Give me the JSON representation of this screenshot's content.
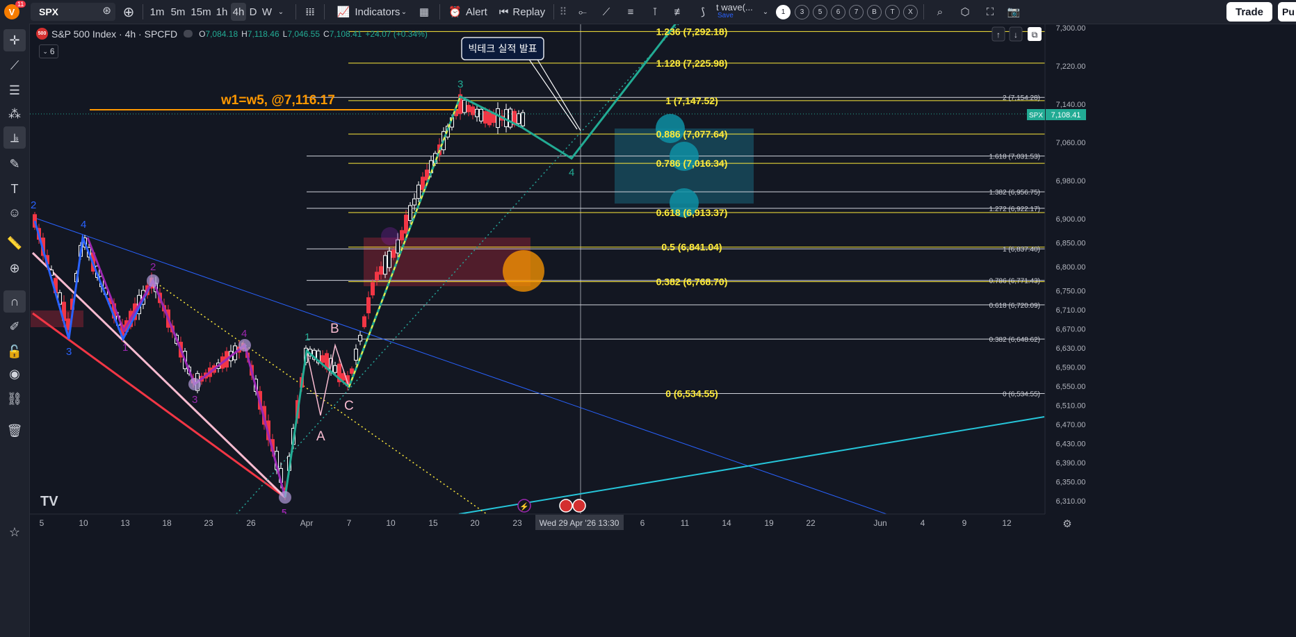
{
  "app": {
    "avatar_letter": "V",
    "notif_count": "11"
  },
  "toolbar": {
    "symbol": "SPX",
    "intervals": [
      "1m",
      "5m",
      "15m",
      "1h",
      "4h",
      "D",
      "W"
    ],
    "active_interval": "4h",
    "indicators_label": "Indicators",
    "alert_label": "Alert",
    "replay_label": "Replay",
    "template_name": "t wave(...",
    "template_save": "Save",
    "number_buttons": [
      "1",
      "3",
      "5",
      "6",
      "7",
      "B",
      "T",
      "X"
    ],
    "selected_number": "1",
    "trade_label": "Trade",
    "publish_label": "Pu"
  },
  "legend": {
    "logo_text": "500",
    "title": "S&P 500 Index · 4h · SPCFD",
    "o_label": "O",
    "o_value": "7,084.18",
    "h_label": "H",
    "h_value": "7,118.46",
    "l_label": "L",
    "l_value": "7,046.55",
    "c_label": "C",
    "c_value": "7,108.41",
    "change": "+24.07 (+0.34%)",
    "collapse_count": "6"
  },
  "price_axis": {
    "ticks": [
      "7,300.00",
      "7,220.00",
      "7,140.00",
      "7,060.00",
      "6,980.00",
      "6,900.00",
      "6,850.00",
      "6,800.00",
      "6,750.00",
      "6,710.00",
      "6,670.00",
      "6,630.00",
      "6,590.00",
      "6,550.00",
      "6,510.00",
      "6,470.00",
      "6,430.00",
      "6,390.00",
      "6,350.00",
      "6,310.00"
    ],
    "current_symbol": "SPX",
    "current_price": "7,108.41"
  },
  "time_axis": {
    "ticks": [
      "5",
      "10",
      "13",
      "18",
      "23",
      "26",
      "Apr",
      "7",
      "10",
      "15",
      "20",
      "23",
      "6",
      "11",
      "14",
      "19",
      "22",
      "Jun",
      "4",
      "9",
      "12"
    ],
    "crosshair_label": "Wed 29 Apr '26   13:30"
  },
  "annotations": {
    "target_note": "w1=w5, @7,116.17",
    "callout": "빅테크 실적 발표"
  },
  "fib_levels_yellow": [
    {
      "label": "1.236 (7,292.18)",
      "price": 7292.18
    },
    {
      "label": "1.128 (7,225.98)",
      "price": 7225.98
    },
    {
      "label": "1 (7,147.52)",
      "price": 7147.52
    },
    {
      "label": "0.886 (7,077.64)",
      "price": 7077.64
    },
    {
      "label": "0.786 (7,016.34)",
      "price": 7016.34
    },
    {
      "label": "0.618 (6,913.37)",
      "price": 6913.37
    },
    {
      "label": "0.5 (6,841.04)",
      "price": 6841.04
    },
    {
      "label": "0.382 (6,768.70)",
      "price": 6768.7
    },
    {
      "label": "0 (6,534.55)",
      "price": 6534.55
    }
  ],
  "fib_levels_white": [
    {
      "label": "2 (7,154.28)",
      "price": 7154.28
    },
    {
      "label": "1.618 (7,031.53)",
      "price": 7031.53
    },
    {
      "label": "1.382 (6,956.75)",
      "price": 6956.75
    },
    {
      "label": "1.272 (6,922.17)",
      "price": 6922.17
    },
    {
      "label": "1 (6,837.40)",
      "price": 6837.4
    },
    {
      "label": "0.786 (6,771.43)",
      "price": 6771.43
    },
    {
      "label": "0.618 (6,720.09)",
      "price": 6720.09
    },
    {
      "label": "0.382 (6,648.62)",
      "price": 6648.62
    },
    {
      "label": "0 (6,534.55)",
      "price": 6534.55
    }
  ],
  "wave_labels": {
    "blue": [
      "2",
      "4",
      "3"
    ],
    "purple": [
      "2",
      "4",
      "1",
      "3"
    ],
    "green": [
      "1",
      "3",
      "4"
    ],
    "pink": [
      "B",
      "A",
      "C"
    ],
    "bottom_marker": "5"
  },
  "colors": {
    "background": "#131722",
    "panel": "#1e222d",
    "up": "#26a69a",
    "down": "#f23645",
    "fib_yellow": "#ffeb3b",
    "orange": "#ff9800",
    "teal": "#22ab94",
    "blue_wave": "#2962ff",
    "purple_wave": "#9c27b0"
  }
}
